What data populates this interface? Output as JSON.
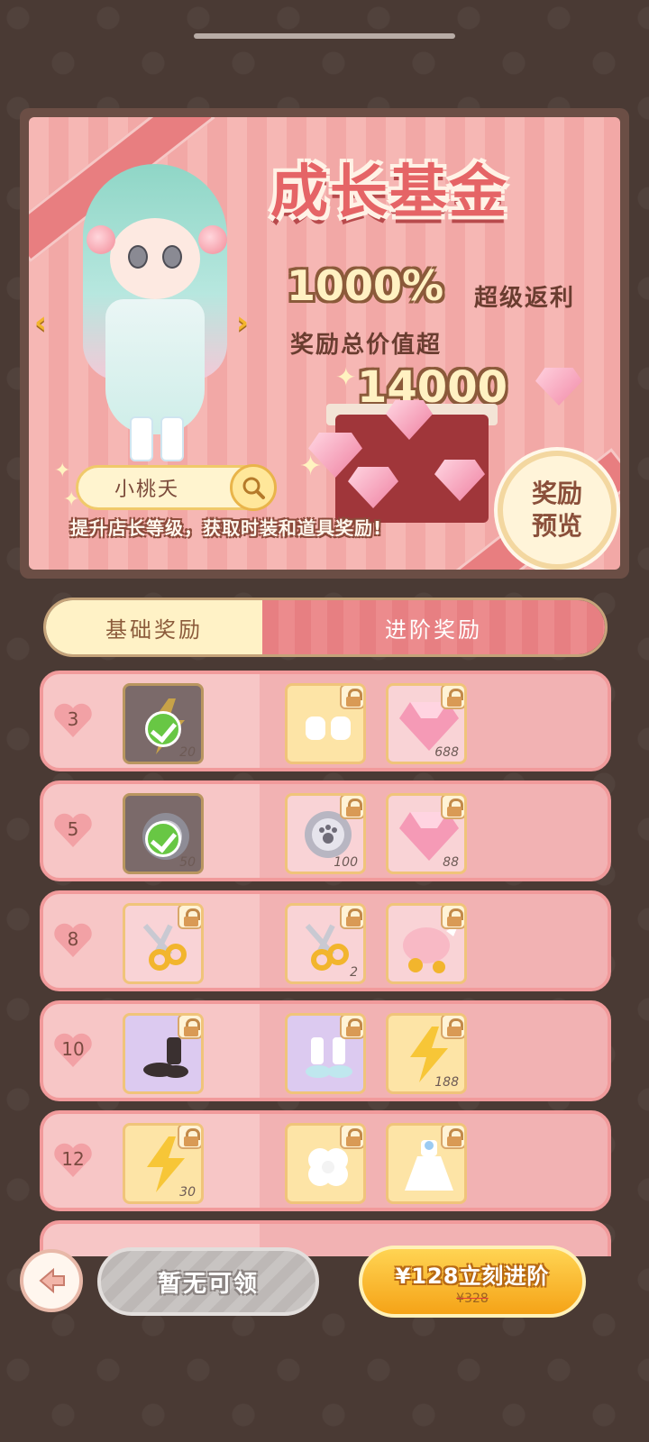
{
  "banner": {
    "title": "成长基金",
    "percent": "1000%",
    "rebate_label": "超级返利",
    "total_label": "奖励总价值超",
    "total_amount": "14000",
    "character_name": "小桃夭",
    "hint": "提升店长等级，获取时装和道具奖励!",
    "preview_line1": "奖励",
    "preview_line2": "预览"
  },
  "tabs": [
    {
      "label": "基础奖励",
      "selected": true
    },
    {
      "label": "进阶奖励",
      "selected": false
    }
  ],
  "rows": [
    {
      "level": "3",
      "basic": {
        "item": "lightning-energy",
        "qty": "20",
        "claimed": true
      },
      "advanced": [
        {
          "item": "white-gloves",
          "qty": "",
          "locked": true
        },
        {
          "item": "pink-diamond",
          "qty": "688",
          "locked": true
        }
      ]
    },
    {
      "level": "5",
      "basic": {
        "item": "paw-coin",
        "qty": "50",
        "claimed": true
      },
      "advanced": [
        {
          "item": "paw-coin",
          "qty": "100",
          "locked": true
        },
        {
          "item": "pink-diamond",
          "qty": "88",
          "locked": true
        }
      ]
    },
    {
      "level": "8",
      "basic": {
        "item": "scissors",
        "qty": "",
        "locked": true
      },
      "advanced": [
        {
          "item": "scissors",
          "qty": "2",
          "locked": true
        },
        {
          "item": "piggy-bank",
          "qty": "",
          "locked": true
        }
      ]
    },
    {
      "level": "10",
      "basic": {
        "item": "black-boots",
        "qty": "",
        "locked": true
      },
      "advanced": [
        {
          "item": "white-shoes",
          "qty": "",
          "locked": true
        },
        {
          "item": "lightning-energy",
          "qty": "188",
          "locked": true
        }
      ]
    },
    {
      "level": "12",
      "basic": {
        "item": "lightning-energy",
        "qty": "30",
        "locked": true
      },
      "advanced": [
        {
          "item": "white-flower",
          "qty": "",
          "locked": true
        },
        {
          "item": "white-dress",
          "qty": "",
          "locked": true
        }
      ]
    }
  ],
  "footer": {
    "disabled_label": "暂无可领",
    "buy_label": "¥128立刻进阶",
    "original_price": "¥328"
  },
  "colors": {
    "background": "#4a3a34",
    "accent_pink": "#e77f82",
    "gold": "#f5a317"
  }
}
